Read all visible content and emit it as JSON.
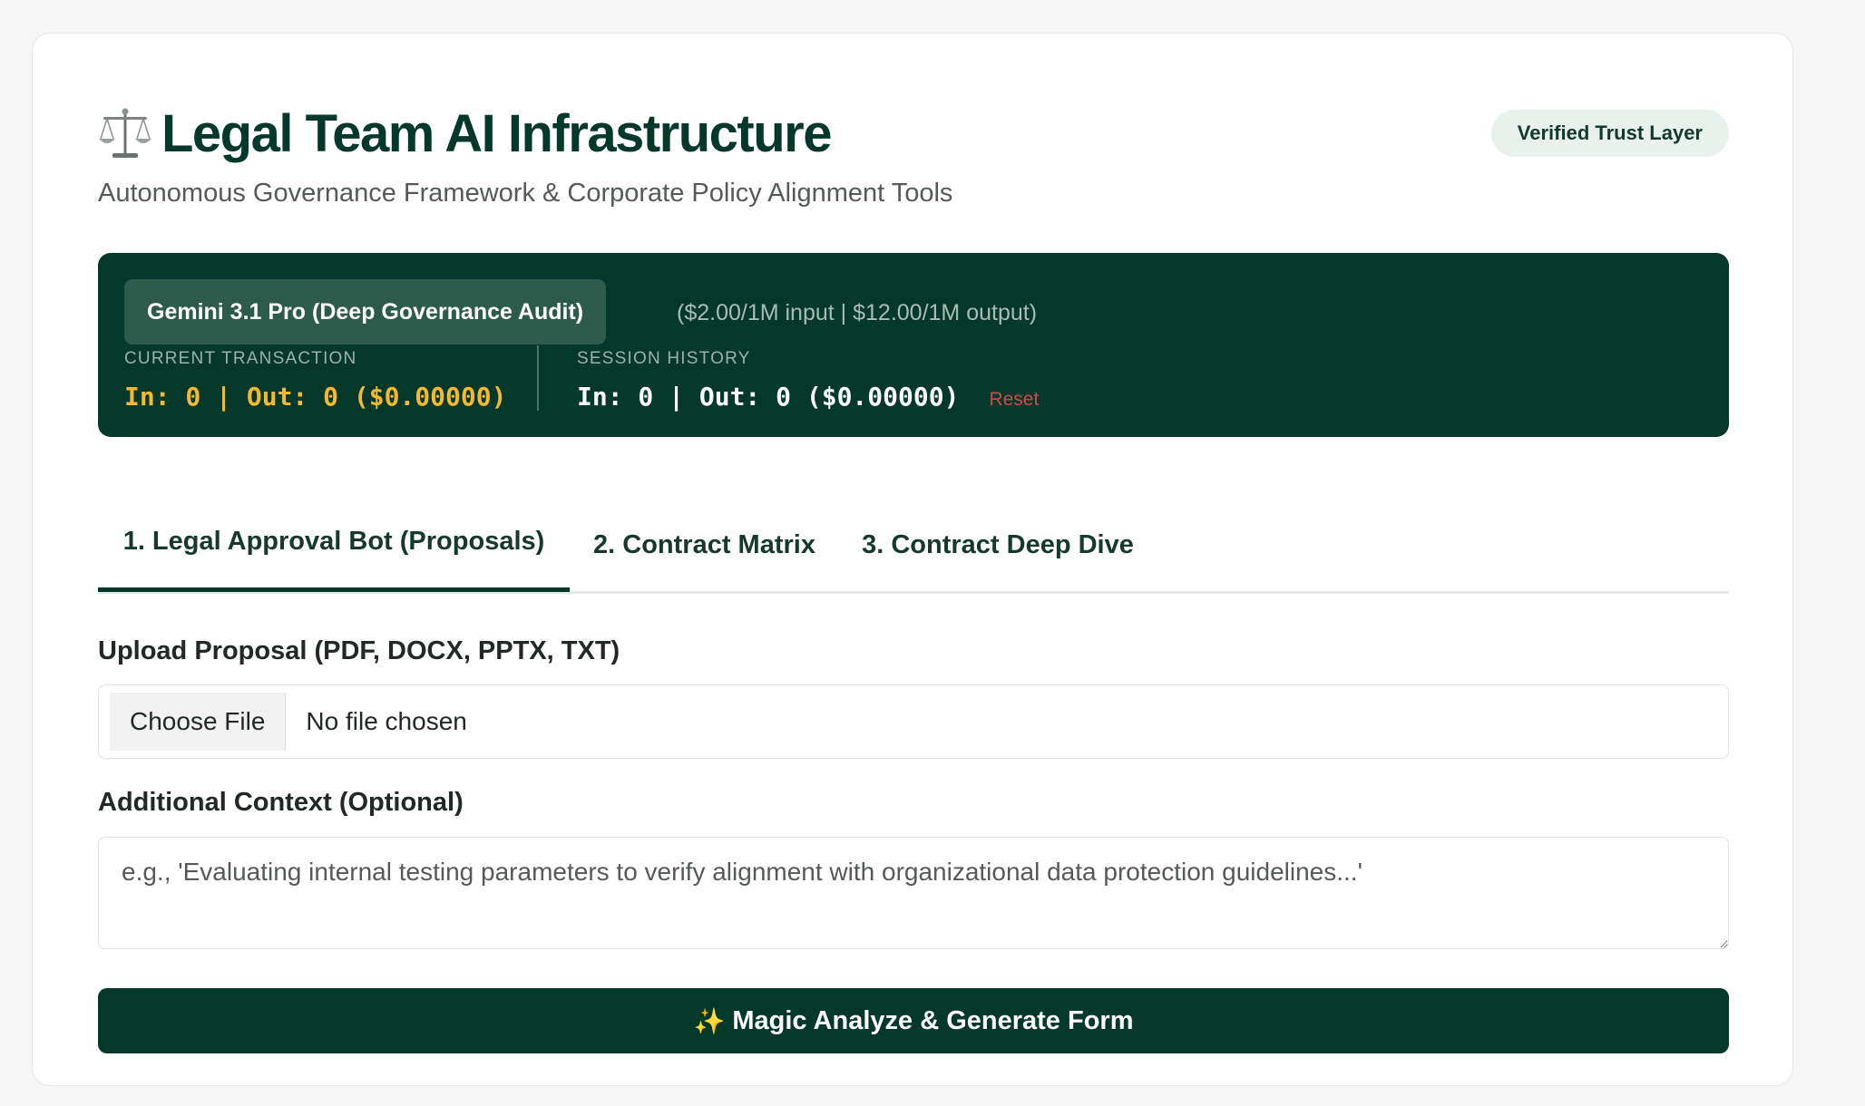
{
  "header": {
    "title_icon": "balance-scale-icon",
    "title": "Legal Team AI Infrastructure",
    "subtitle": "Autonomous Governance Framework & Corporate Policy Alignment Tools",
    "badge": "Verified Trust Layer"
  },
  "cost_panel": {
    "model_label": "Gemini 3.1 Pro (Deep Governance Audit)",
    "pricing": "($2.00/1M input | $12.00/1M output)",
    "current": {
      "label": "CURRENT TRANSACTION",
      "value": "In: 0 | Out: 0 ($0.00000)"
    },
    "session": {
      "label": "SESSION HISTORY",
      "value": "In: 0 | Out: 0 ($0.00000)",
      "reset_label": "Reset"
    },
    "colors": {
      "panel_bg": "#04382a",
      "current_value": "#f5b82e",
      "reset": "#d14a4a"
    }
  },
  "tabs": [
    {
      "label": "1. Legal Approval Bot (Proposals)",
      "active": true
    },
    {
      "label": "2. Contract Matrix",
      "active": false
    },
    {
      "label": "3. Contract Deep Dive",
      "active": false
    }
  ],
  "form": {
    "upload_label": "Upload Proposal (PDF, DOCX, PPTX, TXT)",
    "choose_file_label": "Choose File",
    "file_status": "No file chosen",
    "context_label": "Additional Context (Optional)",
    "context_value": "",
    "context_placeholder": "e.g., 'Evaluating internal testing parameters to verify alignment with organizational data protection guidelines...'",
    "submit_icon": "sparkles-icon",
    "submit_label": "Magic Analyze & Generate Form"
  }
}
